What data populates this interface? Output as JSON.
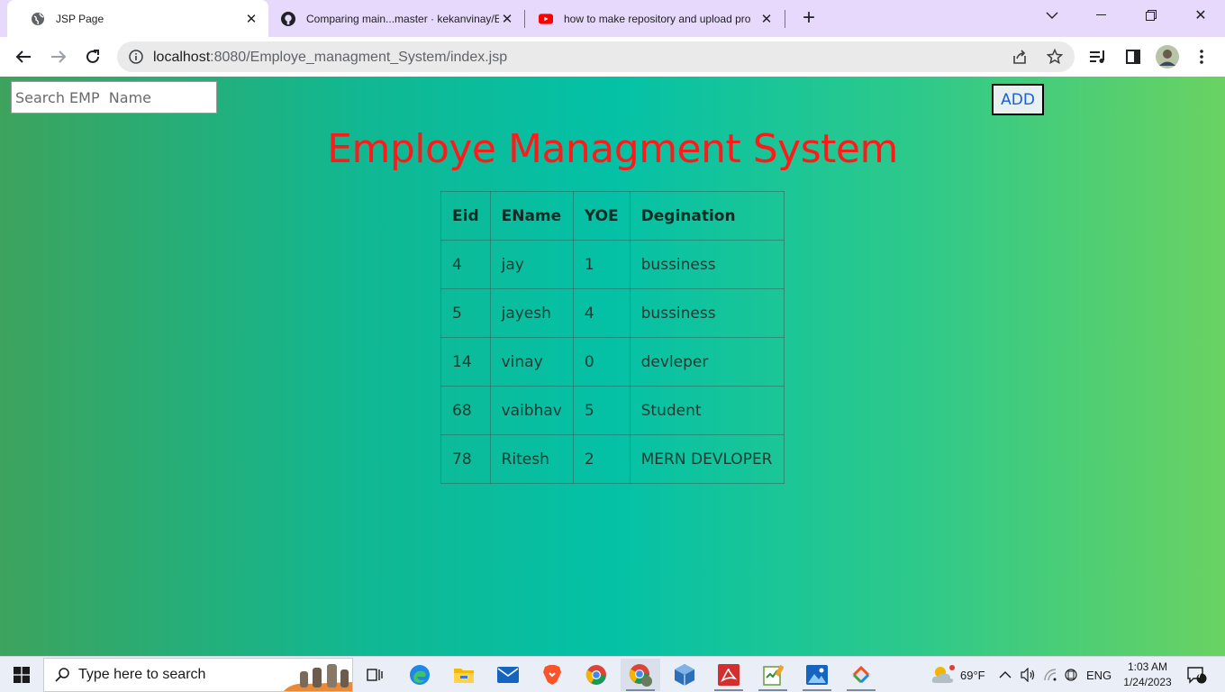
{
  "browser": {
    "tabs": [
      {
        "title": "JSP Page",
        "active": true,
        "icon": "globe-icon"
      },
      {
        "title": "Comparing main...master · kekanvinay/E",
        "active": false,
        "icon": "github-icon"
      },
      {
        "title": "how to make repository and upload pro",
        "active": false,
        "icon": "youtube-icon"
      }
    ],
    "new_tab": "+",
    "url_host": "localhost",
    "url_rest": ":8080/Employe_managment_System/index.jsp"
  },
  "page": {
    "search_placeholder": "Search EMP  Name",
    "add_label": "ADD",
    "title": "Employe Managment System",
    "table": {
      "headers": [
        "Eid",
        "EName",
        "YOE",
        "Degination"
      ],
      "rows": [
        [
          "4",
          "jay",
          "1",
          "bussiness"
        ],
        [
          "5",
          "jayesh",
          "4",
          "bussiness"
        ],
        [
          "14",
          "vinay",
          "0",
          "devleper"
        ],
        [
          "68",
          "vaibhav",
          "5",
          "Student"
        ],
        [
          "78",
          "Ritesh",
          "2",
          "MERN DEVLOPER"
        ]
      ]
    }
  },
  "taskbar": {
    "search_label": "Type here to search",
    "weather": "69°F",
    "lang": "ENG",
    "time": "1:03 AM",
    "date": "1/24/2023",
    "notifications": "7",
    "apps": [
      "task-view-icon",
      "edge-icon",
      "file-explorer-icon",
      "mail-icon",
      "brave-icon",
      "chrome-icon",
      "chrome-profile-icon",
      "virtualbox-icon",
      "acrobat-icon",
      "notepad-icon",
      "photos-icon",
      "git-icon"
    ]
  },
  "colors": {
    "title": "#ff1a1a",
    "tab_strip": "#e7d9fb",
    "gradient": [
      "#3da35d",
      "#04c1a6",
      "#6ad262"
    ]
  }
}
